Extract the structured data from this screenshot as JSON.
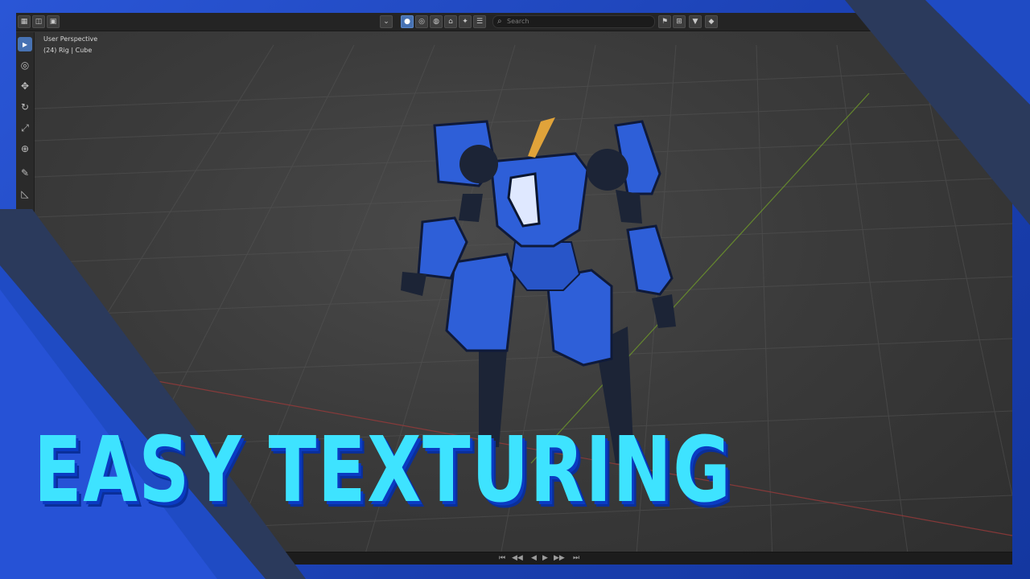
{
  "viewport": {
    "view_name": "User Perspective",
    "object_info": "(24) Rig | Cube"
  },
  "header": {
    "search_placeholder": "Search"
  },
  "toolbar": {
    "tools": [
      "select-box-icon",
      "cursor-icon",
      "move-icon",
      "rotate-icon",
      "scale-icon",
      "transform-icon",
      "annotate-icon",
      "measure-icon",
      "add-cube-icon"
    ]
  },
  "title": {
    "text": "EASY TEXTURING"
  },
  "colors": {
    "title_fill": "#3ee3ff",
    "title_shadow": "#0a3bc2",
    "frame_blue": "#1f4bc4",
    "robot_blue": "#2e5fd8",
    "robot_dark": "#1c2436",
    "robot_accent": "#e0a33a"
  }
}
